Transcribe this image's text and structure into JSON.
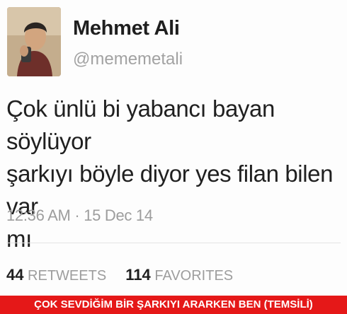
{
  "tweet": {
    "avatar_icon": "user-photo",
    "display_name": "Mehmet Ali",
    "handle": "@mememetali",
    "text_lines": [
      "Çok ünlü bi yabancı bayan söylüyor",
      "şarkıyı böyle diyor yes filan bilen var",
      "mı"
    ],
    "timestamp": "12:36 AM · 15 Dec 14",
    "retweets": {
      "count": "44",
      "label": "RETWEETS"
    },
    "favorites": {
      "count": "114",
      "label": "FAVORITES"
    }
  },
  "caption": "ÇOK SEVDİĞİM BİR ŞARKIYI ARARKEN BEN (TEMSİLİ)",
  "colors": {
    "caption_bg": "#e51818",
    "caption_text": "#ffffff"
  }
}
